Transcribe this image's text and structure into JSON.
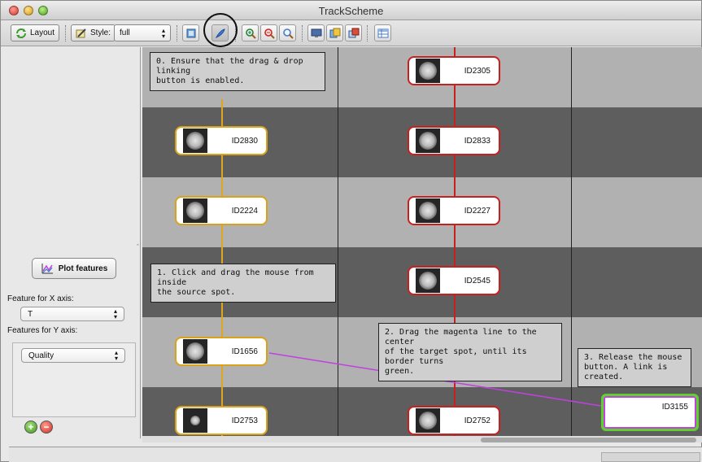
{
  "window": {
    "title": "TrackScheme"
  },
  "toolbar": {
    "layout_label": "Layout",
    "style_label": "Style:",
    "style_value": "full"
  },
  "left_panel": {
    "plot_features_label": "Plot features",
    "feature_x_label": "Feature for X axis:",
    "feature_x_value": "T",
    "feature_y_label": "Features for Y axis:",
    "feature_y_value": "Quality"
  },
  "notes": {
    "n0": [
      "0. Ensure that the drag & drop linking",
      "button is enabled."
    ],
    "n1": [
      "1. Click and drag the mouse from inside",
      "the source spot."
    ],
    "n2": [
      "2. Drag the magenta line to the center",
      "of the target spot, until its border turns",
      "green."
    ],
    "n3": [
      "3. Release the mouse",
      "button. A link is created."
    ]
  },
  "spots": {
    "s2305": "ID2305",
    "s2830": "ID2830",
    "s2833": "ID2833",
    "s2224": "ID2224",
    "s2227": "ID2227",
    "s2545": "ID2545",
    "s1656": "ID1656",
    "s3155": "ID3155",
    "s2753": "ID2753",
    "s2752": "ID2752"
  },
  "colors": {
    "orange_track": "#e0a51a",
    "red_track": "#c8201e",
    "link_line": "#c040e0",
    "target_border": "#5fd12d"
  }
}
